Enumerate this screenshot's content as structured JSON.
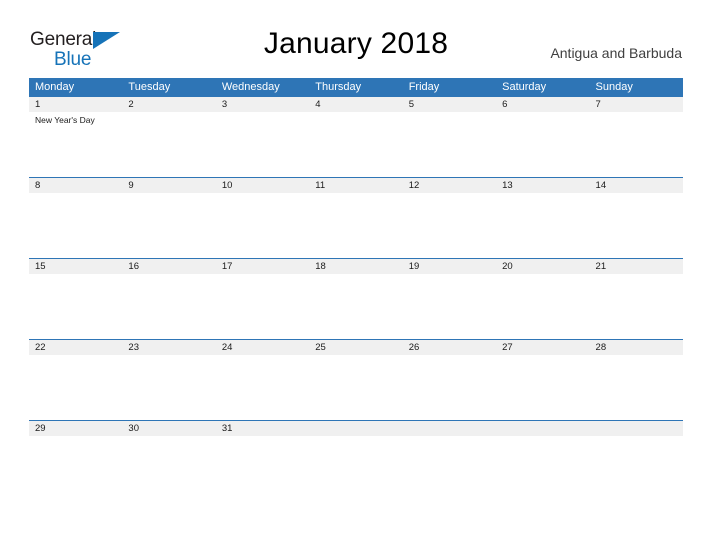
{
  "brand": {
    "word1": "General",
    "word2": "Blue",
    "triangle_color": "#1673b8"
  },
  "header": {
    "title": "January 2018",
    "locale": "Antigua and Barbuda"
  },
  "calendar": {
    "accent_color": "#2e75b6",
    "number_band_color": "#f0f0f0",
    "day_names": [
      "Monday",
      "Tuesday",
      "Wednesday",
      "Thursday",
      "Friday",
      "Saturday",
      "Sunday"
    ],
    "weeks": [
      {
        "days": [
          {
            "number": "1",
            "event": "New Year's Day"
          },
          {
            "number": "2",
            "event": ""
          },
          {
            "number": "3",
            "event": ""
          },
          {
            "number": "4",
            "event": ""
          },
          {
            "number": "5",
            "event": ""
          },
          {
            "number": "6",
            "event": ""
          },
          {
            "number": "7",
            "event": ""
          }
        ]
      },
      {
        "days": [
          {
            "number": "8",
            "event": ""
          },
          {
            "number": "9",
            "event": ""
          },
          {
            "number": "10",
            "event": ""
          },
          {
            "number": "11",
            "event": ""
          },
          {
            "number": "12",
            "event": ""
          },
          {
            "number": "13",
            "event": ""
          },
          {
            "number": "14",
            "event": ""
          }
        ]
      },
      {
        "days": [
          {
            "number": "15",
            "event": ""
          },
          {
            "number": "16",
            "event": ""
          },
          {
            "number": "17",
            "event": ""
          },
          {
            "number": "18",
            "event": ""
          },
          {
            "number": "19",
            "event": ""
          },
          {
            "number": "20",
            "event": ""
          },
          {
            "number": "21",
            "event": ""
          }
        ]
      },
      {
        "days": [
          {
            "number": "22",
            "event": ""
          },
          {
            "number": "23",
            "event": ""
          },
          {
            "number": "24",
            "event": ""
          },
          {
            "number": "25",
            "event": ""
          },
          {
            "number": "26",
            "event": ""
          },
          {
            "number": "27",
            "event": ""
          },
          {
            "number": "28",
            "event": ""
          }
        ]
      },
      {
        "days": [
          {
            "number": "29",
            "event": ""
          },
          {
            "number": "30",
            "event": ""
          },
          {
            "number": "31",
            "event": ""
          },
          {
            "number": "",
            "event": ""
          },
          {
            "number": "",
            "event": ""
          },
          {
            "number": "",
            "event": ""
          },
          {
            "number": "",
            "event": ""
          }
        ]
      }
    ]
  }
}
